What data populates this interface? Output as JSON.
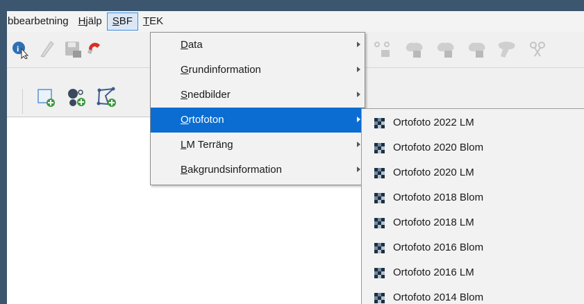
{
  "menubar": {
    "items": [
      {
        "label": "bbearbetning",
        "underline": ""
      },
      {
        "label_pre": "",
        "underline": "H",
        "label_post": "jälp"
      },
      {
        "label_pre": "",
        "underline": "S",
        "label_post": "BF"
      },
      {
        "label_pre": "",
        "underline": "T",
        "label_post": "EK"
      }
    ]
  },
  "sbf_menu": {
    "items": [
      {
        "u": "D",
        "rest": "ata"
      },
      {
        "u": "G",
        "rest": "rundinformation"
      },
      {
        "u": "S",
        "rest": "nedbilder"
      },
      {
        "u": "O",
        "rest": "rtofoton"
      },
      {
        "u": "L",
        "rest": "M Terräng"
      },
      {
        "u": "B",
        "rest": "akgrundsinformation"
      }
    ]
  },
  "ortofoton_submenu": {
    "items": [
      "Ortofoto 2022 LM",
      "Ortofoto 2020 Blom",
      "Ortofoto 2020 LM",
      "Ortofoto 2018 Blom",
      "Ortofoto 2018 LM",
      "Ortofoto 2016 Blom",
      "Ortofoto 2016 LM",
      "Ortofoto 2014 Blom"
    ]
  },
  "colors": {
    "highlight": "#0b6dd1",
    "desktop": "#3b566e",
    "menu_active_border": "#3d8ee0"
  }
}
